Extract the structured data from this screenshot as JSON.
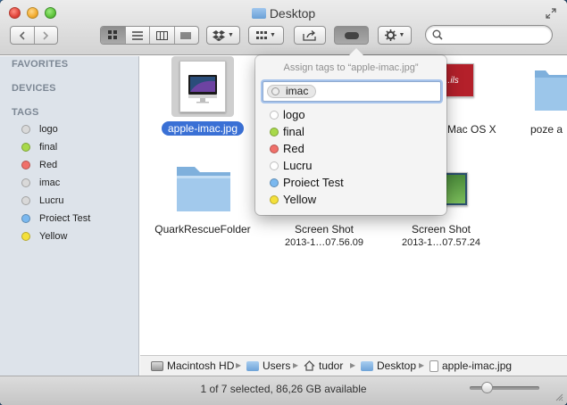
{
  "window": {
    "title": "Desktop"
  },
  "sidebar": {
    "favorites_header": "FAVORITES",
    "devices_header": "DEVICES",
    "tags_header": "TAGS",
    "tags": [
      {
        "label": "logo",
        "color": "#d9d9d9"
      },
      {
        "label": "final",
        "color": "#a8d94a"
      },
      {
        "label": "Red",
        "color": "#f0706a"
      },
      {
        "label": "imac",
        "color": "#d9d9d9"
      },
      {
        "label": "Lucru",
        "color": "#d9d9d9"
      },
      {
        "label": "Proiect Test",
        "color": "#7ab8ef"
      },
      {
        "label": "Yellow",
        "color": "#f4e03a"
      }
    ]
  },
  "content": {
    "items": [
      {
        "name": "apple-imac.jpg",
        "selected": true
      },
      {
        "name": "...ils"
      },
      {
        "name": "Mac OS X"
      },
      {
        "name": "poze a"
      },
      {
        "name": "QuarkRescueFolder"
      },
      {
        "name": "Screen Shot",
        "sub": "2013-1…07.56.09"
      },
      {
        "name": "Screen Shot",
        "sub": "2013-1…07.57.24"
      }
    ]
  },
  "popover": {
    "title": "Assign tags to “apple-imac.jpg”",
    "token": "imac",
    "tags": [
      {
        "label": "logo",
        "color": "#ffffff"
      },
      {
        "label": "final",
        "color": "#a8d94a"
      },
      {
        "label": "Red",
        "color": "#f0706a"
      },
      {
        "label": "Lucru",
        "color": "#ffffff"
      },
      {
        "label": "Proiect Test",
        "color": "#7ab8ef"
      },
      {
        "label": "Yellow",
        "color": "#f4e03a"
      }
    ]
  },
  "pathbar": {
    "crumbs": [
      "Macintosh HD",
      "Users",
      "tudor",
      "Desktop",
      "apple-imac.jpg"
    ]
  },
  "status": {
    "text": "1 of 7 selected, 86,26 GB available",
    "zoom_level": 0.2
  }
}
